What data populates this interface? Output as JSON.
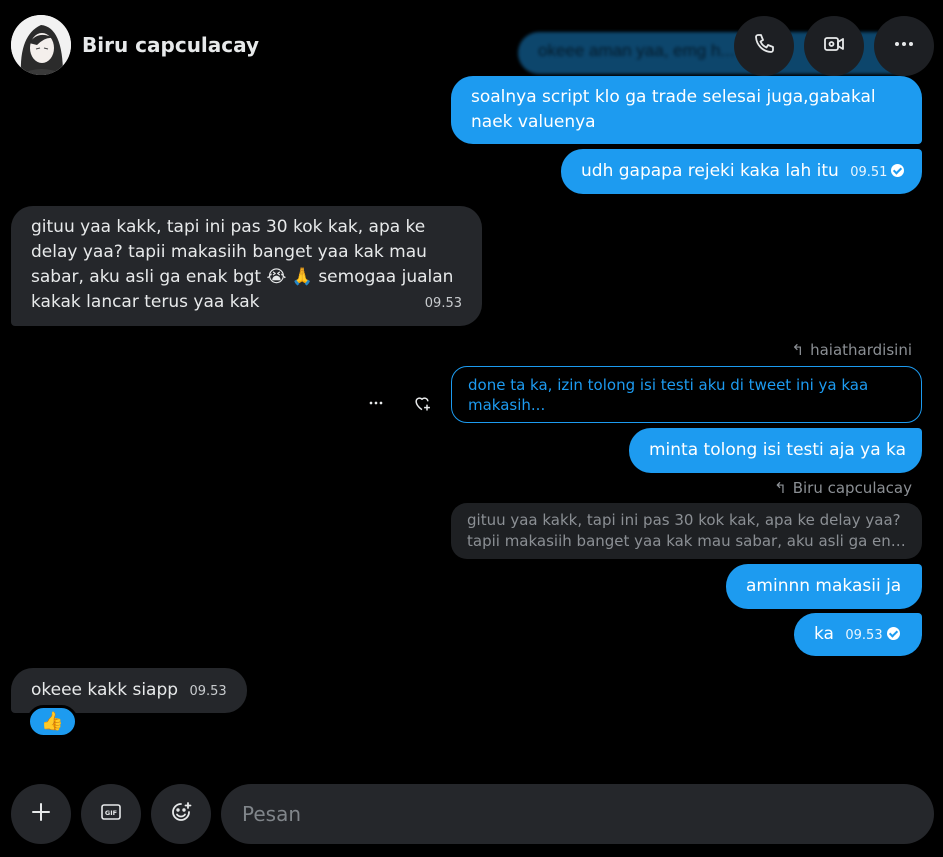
{
  "header": {
    "contact_name": "Biru capculacay"
  },
  "ghost_message": "okeee aman yaa, emg h...",
  "messages": [
    {
      "id": "m1",
      "dir": "out",
      "text": "soalnya script klo ga trade selesai juga,gabakal naek valuenya"
    },
    {
      "id": "m2",
      "dir": "out",
      "text": "udh gapapa rejeki kaka lah itu",
      "time": "09.51"
    },
    {
      "id": "m3",
      "dir": "in",
      "text": "gituu yaa kakk, tapi ini pas 30 kok kak, apa ke delay yaa? tapii makasiih banget yaa kak mau sabar, aku asli ga enak bgt 😭 🙏 semogaa jualan kakak lancar terus yaa kak",
      "time": "09.53"
    },
    {
      "id": "m4",
      "dir": "out",
      "text": "minta tolong isi testi aja ya ka"
    },
    {
      "id": "m5",
      "dir": "out",
      "text": "aminnn makasii ja"
    },
    {
      "id": "m6",
      "dir": "out",
      "text": "ka",
      "time": "09.53"
    },
    {
      "id": "m7",
      "dir": "in",
      "text": "okeee kakk siapp",
      "time": "09.53"
    }
  ],
  "replies": {
    "reply1_label": "haiathardisini",
    "reply1_quote": "done ta ka, izin tolong isi testi aku di tweet ini ya kaa makasih...",
    "reply2_label": "Biru capculacay",
    "reply2_quote_line1": "gituu yaa kakk, tapi ini pas 30 kok kak, apa ke delay yaa?",
    "reply2_quote_line2": "tapii makasiih banget yaa kak mau sabar, aku asli ga enak..."
  },
  "reaction": "👍",
  "composer": {
    "placeholder": "Pesan"
  },
  "icons": {
    "header": [
      "phone-icon",
      "video-icon",
      "more-icon"
    ],
    "composer": [
      "plus-icon",
      "gif-icon",
      "emoji-icon"
    ],
    "message_actions": [
      "more-icon",
      "react-heart-icon"
    ]
  },
  "colors": {
    "accent": "#1d9bf0",
    "incoming_bubble": "#25272b",
    "background": "#000000"
  }
}
